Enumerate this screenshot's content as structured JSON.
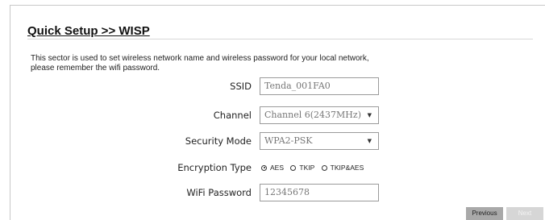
{
  "page": {
    "title": "Quick Setup >> WISP",
    "description_line1": "This sector is used to set wireless network name and wireless password for your local network,",
    "description_line2": "please remember the wifi password."
  },
  "form": {
    "ssid": {
      "label": "SSID",
      "value": "Tenda_001FA0"
    },
    "channel": {
      "label": "Channel",
      "selected": "Channel 6(2437MHz)"
    },
    "security_mode": {
      "label": "Security Mode",
      "selected": "WPA2-PSK"
    },
    "encryption_type": {
      "label": "Encryption Type",
      "options": [
        "AES",
        "TKIP",
        "TKIP&AES"
      ],
      "selected": "AES"
    },
    "wifi_password": {
      "label": "WiFi Password",
      "value": "12345678"
    }
  },
  "buttons": {
    "previous": "Previous",
    "next": "Next"
  }
}
